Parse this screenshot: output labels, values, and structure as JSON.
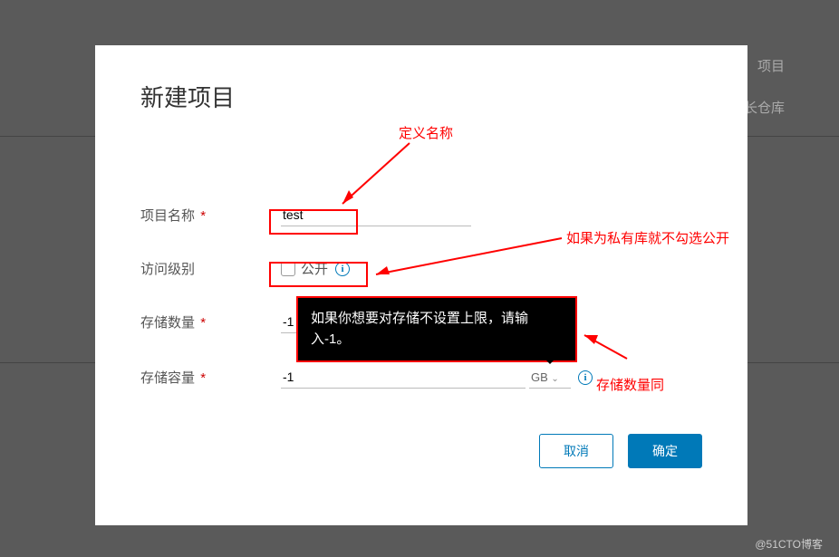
{
  "bg": {
    "tab1": "项目",
    "tab2": "长仓库"
  },
  "modal": {
    "title": "新建项目",
    "projectName": {
      "label": "项目名称",
      "value": "test"
    },
    "access": {
      "label": "访问级别",
      "checkboxLabel": "公开"
    },
    "quota": {
      "label": "存储数量",
      "value": "-1"
    },
    "storage": {
      "label": "存储容量",
      "value": "-1",
      "unit": "GB"
    },
    "cancel": "取消",
    "ok": "确定"
  },
  "tooltip": "如果你想要对存储不设置上限，请输入-1。",
  "ann": {
    "defineName": "定义名称",
    "private": "如果为私有库就不勾选公开",
    "quotaSame": "存储数量同"
  },
  "watermark": "@51CTO博客"
}
